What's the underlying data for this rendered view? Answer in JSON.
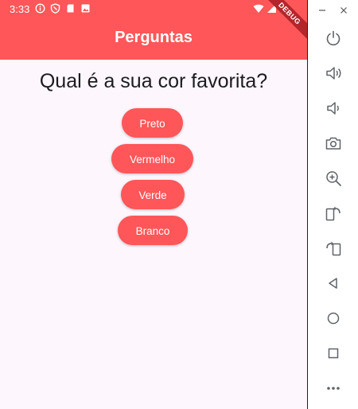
{
  "statusbar": {
    "time": "3:33"
  },
  "appbar": {
    "title": "Perguntas",
    "debug_banner": "DEBUG",
    "color": "#fe5659"
  },
  "quiz": {
    "question": "Qual é a sua cor favorita?",
    "answers": [
      {
        "label": "Preto"
      },
      {
        "label": "Vermelho"
      },
      {
        "label": "Verde"
      },
      {
        "label": "Branco"
      }
    ]
  },
  "emulator": {
    "window_controls": [
      "minimize-icon",
      "close-icon"
    ],
    "tools": [
      "power-icon",
      "volume-up-icon",
      "volume-down-icon",
      "camera-icon",
      "zoom-in-icon",
      "rotate-left-icon",
      "rotate-right-icon",
      "back-icon",
      "home-icon",
      "overview-icon",
      "more-icon"
    ]
  }
}
